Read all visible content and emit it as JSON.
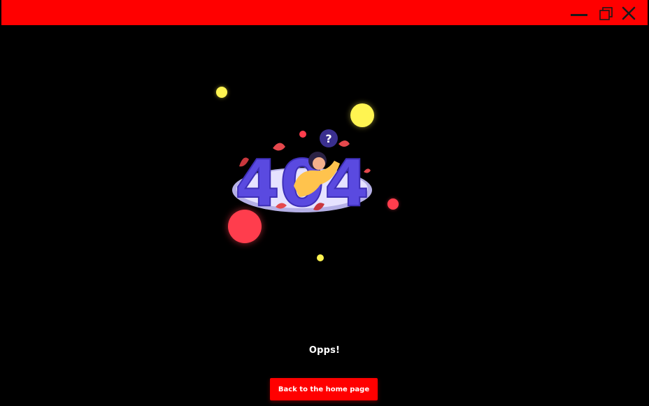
{
  "window": {
    "controls": [
      {
        "name": "minimize",
        "icon": "minimize-icon"
      },
      {
        "name": "restore",
        "icon": "restore-icon"
      },
      {
        "name": "close",
        "icon": "close-icon"
      }
    ]
  },
  "illustration": {
    "text": "404",
    "badge": "?"
  },
  "main": {
    "message": "Opps!",
    "home_button_label": "Back to the home page"
  },
  "colors": {
    "titlebar": "#ff0000",
    "background": "#000000",
    "accent_red": "#ff3d4d",
    "accent_yellow": "#fff451",
    "illustration_purple": "#6b5cf0"
  }
}
